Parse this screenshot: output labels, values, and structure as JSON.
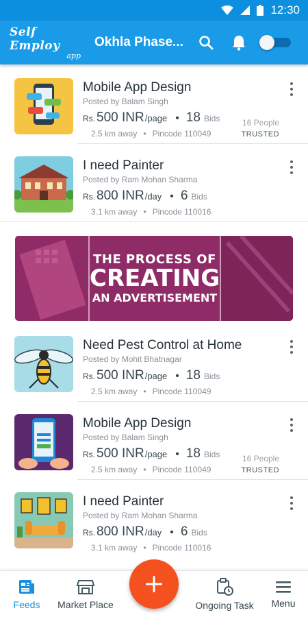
{
  "status_bar": {
    "time": "12:30"
  },
  "app_bar": {
    "logo_line1": "Self Employ",
    "logo_line2": "app",
    "location": "Okhla Phase..."
  },
  "feed": [
    {
      "title": "Mobile App Design",
      "posted_by": "Posted by Balam Singh",
      "currency": "Rs.",
      "amount": "500 INR",
      "unit": "/page",
      "bids_count": "18",
      "bids_label": "Bids",
      "distance": "2.5 km away",
      "pincode": "Pincode 110049",
      "people": "16 People",
      "trusted": "TRUSTED"
    },
    {
      "title": "I need Painter",
      "posted_by": "Posted by Ram Mohan Sharma",
      "currency": "Rs.",
      "amount": "800 INR",
      "unit": "/day",
      "bids_count": "6",
      "bids_label": "Bids",
      "distance": "3.1 km away",
      "pincode": "Pincode 110016"
    },
    {
      "title": "Need Pest Control at Home",
      "posted_by": "Posted by Mohit Bhatnagar",
      "currency": "Rs.",
      "amount": "500 INR",
      "unit": "/page",
      "bids_count": "18",
      "bids_label": "Bids",
      "distance": "2.5 km away",
      "pincode": "Pincode 110049"
    },
    {
      "title": "Mobile App Design",
      "posted_by": "Posted by Balam Singh",
      "currency": "Rs.",
      "amount": "500 INR",
      "unit": "/page",
      "bids_count": "18",
      "bids_label": "Bids",
      "distance": "2.5 km away",
      "pincode": "Pincode 110049",
      "people": "16 People",
      "trusted": "TRUSTED"
    },
    {
      "title": "I need Painter",
      "posted_by": "Posted by Ram Mohan Sharma",
      "currency": "Rs.",
      "amount": "800 INR",
      "unit": "/day",
      "bids_count": "6",
      "bids_label": "Bids",
      "distance": "3.1 km away",
      "pincode": "Pincode 110016"
    }
  ],
  "banner": {
    "line1": "THE PROCESS OF",
    "line2": "CREATING",
    "line3": "AN ADVERTISEMENT"
  },
  "bottom_nav": {
    "feeds": "Feeds",
    "market_place": "Market Place",
    "ongoing_task": "Ongoing Task",
    "menu": "Menu"
  },
  "colors": {
    "app_bar": "#1a9be8",
    "status_bar": "#0d8fe0",
    "fab": "#f4511e",
    "active_nav": "#1a8fe0",
    "banner": "#9b2f6e"
  },
  "icons": [
    "wifi-icon",
    "signal-icon",
    "battery-icon",
    "search-icon",
    "bell-icon",
    "toggle-switch",
    "more-vert-icon",
    "feeds-icon",
    "store-icon",
    "add-icon",
    "task-icon",
    "menu-icon"
  ]
}
